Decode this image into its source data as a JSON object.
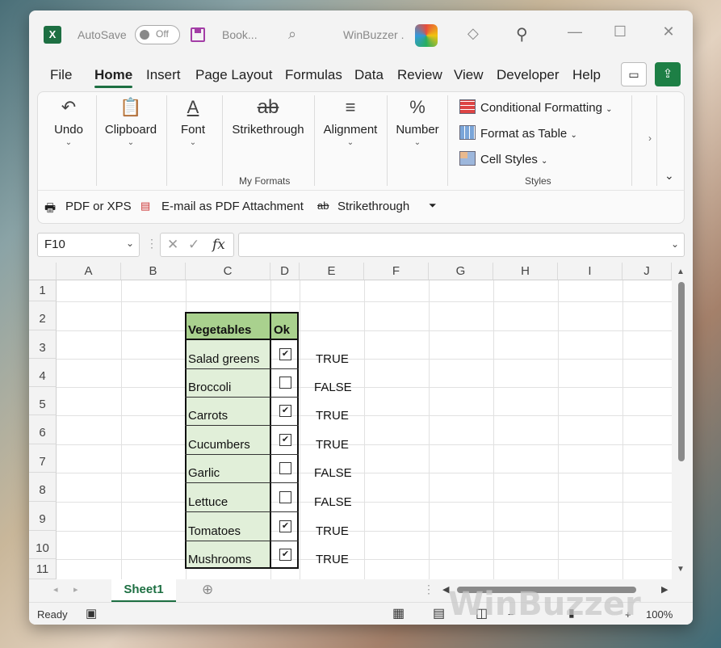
{
  "titlebar": {
    "autosave_label": "AutoSave",
    "autosave_state": "Off",
    "book_name": "Book...",
    "brand": "WinBuzzer .",
    "icons": [
      "excel-logo-icon",
      "save-icon",
      "search-icon",
      "winbuzzer-logo-icon",
      "diamond-icon",
      "magic-wand-icon",
      "minimize-icon",
      "maximize-icon",
      "close-icon"
    ]
  },
  "menu": {
    "items": [
      "File",
      "Home",
      "Insert",
      "Page Layout",
      "Formulas",
      "Data",
      "Review",
      "View",
      "Developer",
      "Help"
    ],
    "active": "Home"
  },
  "ribbon": {
    "undo": "Undo",
    "clipboard": "Clipboard",
    "font": "Font",
    "strikethrough": "Strikethrough",
    "my_formats": "My Formats",
    "alignment": "Alignment",
    "number": "Number",
    "conditional_formatting": "Conditional Formatting",
    "format_as_table": "Format as Table",
    "cell_styles": "Cell Styles",
    "styles_group": "Styles"
  },
  "qat": {
    "pdf": "PDF or XPS",
    "email_pdf": "E-mail as PDF Attachment",
    "strikethrough": "Strikethrough"
  },
  "formula": {
    "name_box": "F10",
    "fx": "fx",
    "value": ""
  },
  "columns": [
    "A",
    "B",
    "C",
    "D",
    "E",
    "F",
    "G",
    "H",
    "I",
    "J"
  ],
  "rows": [
    "1",
    "2",
    "3",
    "4",
    "5",
    "6",
    "7",
    "8",
    "9",
    "10",
    "11"
  ],
  "table": {
    "header_vegetables": "Vegetables",
    "header_ok": "Ok",
    "items": [
      {
        "name": "Salad greens",
        "checked": true,
        "value": "TRUE"
      },
      {
        "name": "Broccoli",
        "checked": false,
        "value": "FALSE"
      },
      {
        "name": "Carrots",
        "checked": true,
        "value": "TRUE"
      },
      {
        "name": "Cucumbers",
        "checked": true,
        "value": "TRUE"
      },
      {
        "name": "Garlic",
        "checked": false,
        "value": "FALSE"
      },
      {
        "name": "Lettuce",
        "checked": false,
        "value": "FALSE"
      },
      {
        "name": "Tomatoes",
        "checked": true,
        "value": "TRUE"
      },
      {
        "name": "Mushrooms",
        "checked": true,
        "value": "TRUE"
      }
    ]
  },
  "sheets": {
    "active": "Sheet1"
  },
  "status": {
    "ready": "Ready",
    "zoom": "100%"
  },
  "watermark": "WinBuzzer",
  "colors": {
    "excel_green": "#1d6f42",
    "header_green": "#a9d18e",
    "cell_green": "#e1efd9"
  }
}
